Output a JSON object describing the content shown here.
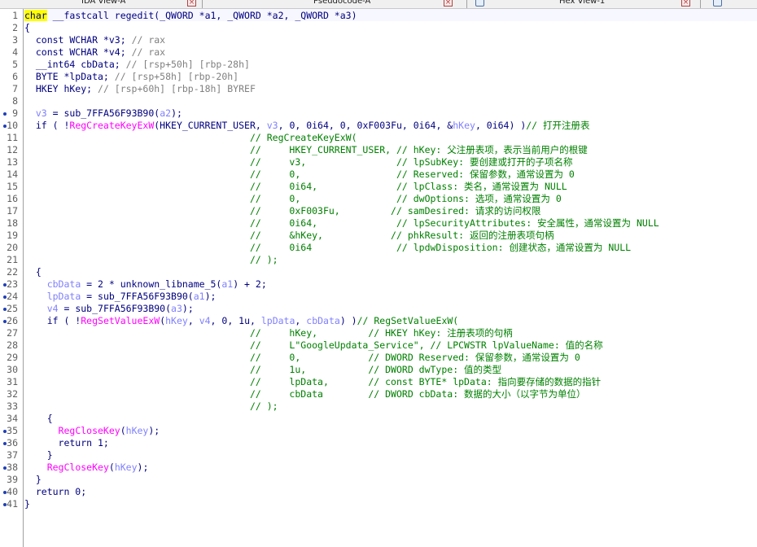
{
  "tabs": [
    {
      "label": "IDA View-A"
    },
    {
      "label": "Pseudocode-A"
    },
    {
      "label": "Hex View-1"
    }
  ],
  "code": {
    "lines": [
      {
        "n": "1",
        "parts": [
          {
            "t": "char",
            "c": "kw-hl"
          },
          {
            "t": " __fastcall regedit(_QWORD *a1, _QWORD *a2, _QWORD *a3)"
          }
        ]
      },
      {
        "n": "2",
        "parts": [
          {
            "t": "{"
          }
        ]
      },
      {
        "n": "3",
        "parts": [
          {
            "t": "  const WCHAR *v3; "
          },
          {
            "t": "// rax",
            "c": "cm-gray"
          }
        ]
      },
      {
        "n": "4",
        "parts": [
          {
            "t": "  const WCHAR *v4; "
          },
          {
            "t": "// rax",
            "c": "cm-gray"
          }
        ]
      },
      {
        "n": "5",
        "parts": [
          {
            "t": "  __int64 cbData; "
          },
          {
            "t": "// [rsp+50h] [rbp-28h]",
            "c": "cm-gray"
          }
        ]
      },
      {
        "n": "6",
        "parts": [
          {
            "t": "  BYTE *lpData; "
          },
          {
            "t": "// [rsp+58h] [rbp-20h]",
            "c": "cm-gray"
          }
        ]
      },
      {
        "n": "7",
        "parts": [
          {
            "t": "  HKEY hKey; "
          },
          {
            "t": "// [rsp+60h] [rbp-18h] BYREF",
            "c": "cm-gray"
          }
        ]
      },
      {
        "n": "8",
        "parts": [
          {
            "t": ""
          }
        ]
      },
      {
        "n": "9",
        "bp": true,
        "parts": [
          {
            "t": "  "
          },
          {
            "t": "v3",
            "c": "var-blue"
          },
          {
            "t": " = sub_7FFA56F93B90("
          },
          {
            "t": "a2",
            "c": "arg-blue"
          },
          {
            "t": ");"
          }
        ]
      },
      {
        "n": "10",
        "bp": true,
        "parts": [
          {
            "t": "  if ( !"
          },
          {
            "t": "RegCreateKeyExW",
            "c": "fn-red"
          },
          {
            "t": "(HKEY_CURRENT_USER, "
          },
          {
            "t": "v3",
            "c": "var-blue"
          },
          {
            "t": ", 0, 0i64, 0, 0xF003Fu, 0i64, &"
          },
          {
            "t": "hKey",
            "c": "var-blue"
          },
          {
            "t": ", 0i64) )"
          },
          {
            "t": "// 打开注册表",
            "c": "cm"
          }
        ]
      },
      {
        "n": "11",
        "parts": [
          {
            "t": "                                        "
          },
          {
            "t": "// RegCreateKeyExW(",
            "c": "cm"
          }
        ]
      },
      {
        "n": "12",
        "parts": [
          {
            "t": "                                        "
          },
          {
            "t": "//     HKEY_CURRENT_USER, // hKey: 父注册表项，表示当前用户的根键",
            "c": "cm"
          }
        ]
      },
      {
        "n": "13",
        "parts": [
          {
            "t": "                                        "
          },
          {
            "t": "//     v3,                // lpSubKey: 要创建或打开的子项名称",
            "c": "cm"
          }
        ]
      },
      {
        "n": "14",
        "parts": [
          {
            "t": "                                        "
          },
          {
            "t": "//     0,                 // Reserved: 保留参数，通常设置为 0",
            "c": "cm"
          }
        ]
      },
      {
        "n": "15",
        "parts": [
          {
            "t": "                                        "
          },
          {
            "t": "//     0i64,              // lpClass: 类名，通常设置为 NULL",
            "c": "cm"
          }
        ]
      },
      {
        "n": "16",
        "parts": [
          {
            "t": "                                        "
          },
          {
            "t": "//     0,                 // dwOptions: 选项，通常设置为 0",
            "c": "cm"
          }
        ]
      },
      {
        "n": "17",
        "parts": [
          {
            "t": "                                        "
          },
          {
            "t": "//     0xF003Fu,         // samDesired: 请求的访问权限",
            "c": "cm"
          }
        ]
      },
      {
        "n": "18",
        "parts": [
          {
            "t": "                                        "
          },
          {
            "t": "//     0i64,              // lpSecurityAttributes: 安全属性，通常设置为 NULL",
            "c": "cm"
          }
        ]
      },
      {
        "n": "19",
        "parts": [
          {
            "t": "                                        "
          },
          {
            "t": "//     &hKey,            // phkResult: 返回的注册表项句柄",
            "c": "cm"
          }
        ]
      },
      {
        "n": "20",
        "parts": [
          {
            "t": "                                        "
          },
          {
            "t": "//     0i64               // lpdwDisposition: 创建状态，通常设置为 NULL",
            "c": "cm"
          }
        ]
      },
      {
        "n": "21",
        "parts": [
          {
            "t": "                                        "
          },
          {
            "t": "// );",
            "c": "cm"
          }
        ]
      },
      {
        "n": "22",
        "parts": [
          {
            "t": "  {"
          }
        ]
      },
      {
        "n": "23",
        "bp": true,
        "parts": [
          {
            "t": "    "
          },
          {
            "t": "cbData",
            "c": "var-blue"
          },
          {
            "t": " = 2 * unknown_libname_5("
          },
          {
            "t": "a1",
            "c": "arg-blue"
          },
          {
            "t": ") + 2;"
          }
        ]
      },
      {
        "n": "24",
        "bp": true,
        "parts": [
          {
            "t": "    "
          },
          {
            "t": "lpData",
            "c": "var-blue"
          },
          {
            "t": " = sub_7FFA56F93B90("
          },
          {
            "t": "a1",
            "c": "arg-blue"
          },
          {
            "t": ");"
          }
        ]
      },
      {
        "n": "25",
        "bp": true,
        "parts": [
          {
            "t": "    "
          },
          {
            "t": "v4",
            "c": "var-blue"
          },
          {
            "t": " = sub_7FFA56F93B90("
          },
          {
            "t": "a3",
            "c": "arg-blue"
          },
          {
            "t": ");"
          }
        ]
      },
      {
        "n": "26",
        "bp": true,
        "parts": [
          {
            "t": "    if ( !"
          },
          {
            "t": "RegSetValueExW",
            "c": "fn-red"
          },
          {
            "t": "("
          },
          {
            "t": "hKey",
            "c": "var-blue"
          },
          {
            "t": ", "
          },
          {
            "t": "v4",
            "c": "var-blue"
          },
          {
            "t": ", 0, 1u, "
          },
          {
            "t": "lpData",
            "c": "var-blue"
          },
          {
            "t": ", "
          },
          {
            "t": "cbData",
            "c": "var-blue"
          },
          {
            "t": ") )"
          },
          {
            "t": "// RegSetValueExW(",
            "c": "cm"
          }
        ]
      },
      {
        "n": "27",
        "parts": [
          {
            "t": "                                        "
          },
          {
            "t": "//     hKey,         // HKEY hKey: 注册表项的句柄",
            "c": "cm"
          }
        ]
      },
      {
        "n": "28",
        "parts": [
          {
            "t": "                                        "
          },
          {
            "t": "//     L\"GoogleUpdata_Service\", // LPCWSTR lpValueName: 值的名称",
            "c": "cm"
          }
        ]
      },
      {
        "n": "29",
        "parts": [
          {
            "t": "                                        "
          },
          {
            "t": "//     0,            // DWORD Reserved: 保留参数，通常设置为 0",
            "c": "cm"
          }
        ]
      },
      {
        "n": "30",
        "parts": [
          {
            "t": "                                        "
          },
          {
            "t": "//     1u,           // DWORD dwType: 值的类型",
            "c": "cm"
          }
        ]
      },
      {
        "n": "31",
        "parts": [
          {
            "t": "                                        "
          },
          {
            "t": "//     lpData,       // const BYTE* lpData: 指向要存储的数据的指针",
            "c": "cm"
          }
        ]
      },
      {
        "n": "32",
        "parts": [
          {
            "t": "                                        "
          },
          {
            "t": "//     cbData        // DWORD cbData: 数据的大小（以字节为单位）",
            "c": "cm"
          }
        ]
      },
      {
        "n": "33",
        "parts": [
          {
            "t": "                                        "
          },
          {
            "t": "// );",
            "c": "cm"
          }
        ]
      },
      {
        "n": "34",
        "parts": [
          {
            "t": "    {"
          }
        ]
      },
      {
        "n": "35",
        "bp": true,
        "parts": [
          {
            "t": "      "
          },
          {
            "t": "RegCloseKey",
            "c": "fn-red"
          },
          {
            "t": "("
          },
          {
            "t": "hKey",
            "c": "var-blue"
          },
          {
            "t": ");"
          }
        ]
      },
      {
        "n": "36",
        "bp": true,
        "parts": [
          {
            "t": "      return 1;"
          }
        ]
      },
      {
        "n": "37",
        "parts": [
          {
            "t": "    }"
          }
        ]
      },
      {
        "n": "38",
        "bp": true,
        "parts": [
          {
            "t": "    "
          },
          {
            "t": "RegCloseKey",
            "c": "fn-red"
          },
          {
            "t": "("
          },
          {
            "t": "hKey",
            "c": "var-blue"
          },
          {
            "t": ");"
          }
        ]
      },
      {
        "n": "39",
        "parts": [
          {
            "t": "  }"
          }
        ]
      },
      {
        "n": "40",
        "bp": true,
        "parts": [
          {
            "t": "  return 0;"
          }
        ]
      },
      {
        "n": "41",
        "bp": true,
        "parts": [
          {
            "t": "}"
          }
        ]
      }
    ]
  }
}
